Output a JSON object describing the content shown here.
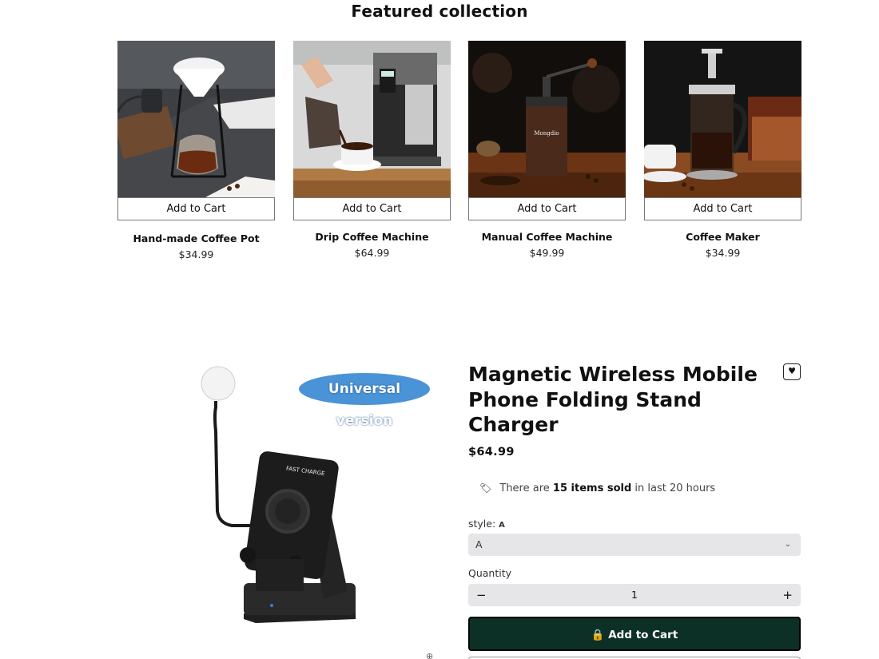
{
  "collection": {
    "title": "Featured collection",
    "products": [
      {
        "name": "Hand-made Coffee Pot",
        "price": "$34.99",
        "cta": "Add to Cart"
      },
      {
        "name": "Drip Coffee Machine",
        "price": "$64.99",
        "cta": "Add to Cart"
      },
      {
        "name": "Manual Coffee Machine",
        "price": "$49.99",
        "cta": "Add to Cart"
      },
      {
        "name": "Coffee Maker",
        "price": "$34.99",
        "cta": "Add to Cart"
      }
    ]
  },
  "product": {
    "badge": "Universal version",
    "title": "Magnetic Wireless Mobile Phone Folding Stand Charger",
    "price": "$64.99",
    "sold_prefix": "There are",
    "sold_count": "15 items sold",
    "sold_suffix": "in last 20 hours",
    "style_label": "style:",
    "style_value": "A",
    "style_selected": "A",
    "quantity_label": "Quantity",
    "quantity_value": "1",
    "minus": "−",
    "plus": "+",
    "add_to_cart": "Add to Cart",
    "charger_text": "FAST CHARGE"
  },
  "colors": {
    "cart_button": "#0c3025",
    "badge": "#4a93d6",
    "field_bg": "#e6e5e8"
  }
}
